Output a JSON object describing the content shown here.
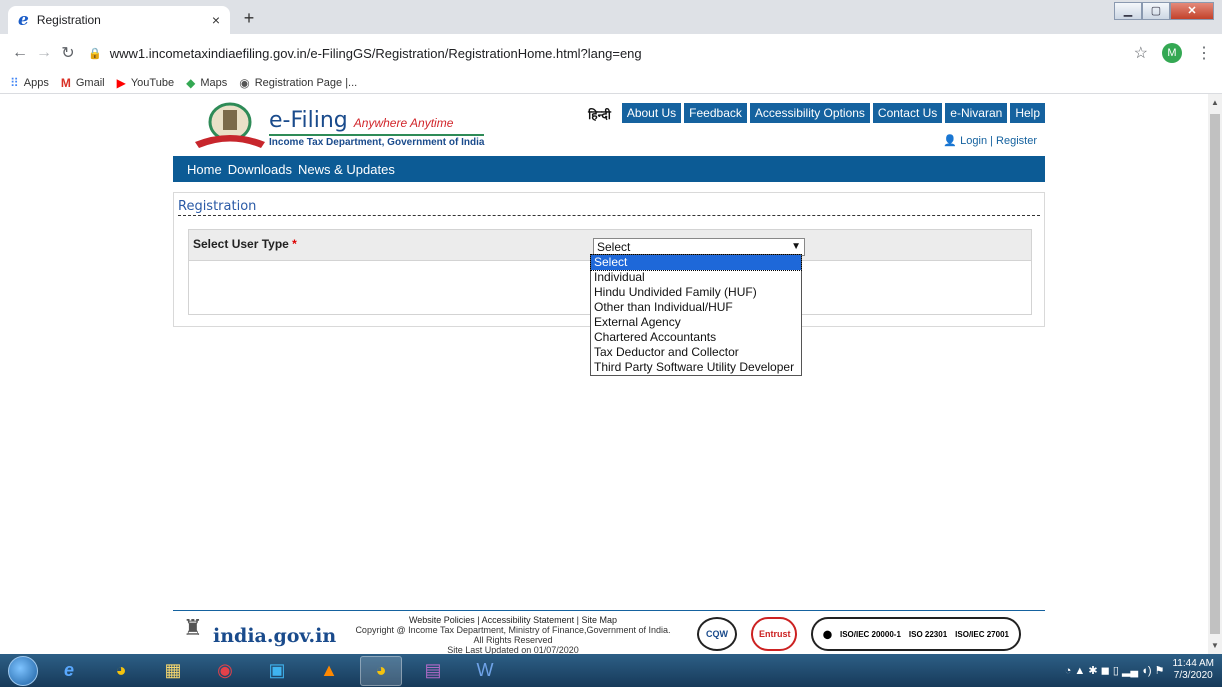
{
  "browser": {
    "tab_title": "Registration",
    "tab_close": "×",
    "new_tab": "+",
    "url": "www1.incometaxindiaefiling.gov.in/e-FilingGS/Registration/RegistrationHome.html?lang=eng",
    "profile_initial": "M",
    "bookmarks": [
      {
        "label": "Apps",
        "icon": "apps-icon"
      },
      {
        "label": "Gmail",
        "icon": "gmail-icon"
      },
      {
        "label": "YouTube",
        "icon": "youtube-icon"
      },
      {
        "label": "Maps",
        "icon": "maps-icon"
      },
      {
        "label": "Registration Page |...",
        "icon": "globe-icon"
      }
    ]
  },
  "header": {
    "brand_main": "e-Filing",
    "brand_tagline": "Anywhere Anytime",
    "brand_dept": "Income Tax Department, Government of India",
    "hindi": "हिन्दी",
    "top_nav": [
      "About Us",
      "Feedback",
      "Accessibility Options",
      "Contact Us",
      "e-Nivaran",
      "Help"
    ],
    "login": "Login | Register"
  },
  "main_nav": [
    "Home",
    "Downloads",
    "News & Updates"
  ],
  "registration": {
    "title": "Registration",
    "user_type_label": "Select User Type",
    "required_mark": "*",
    "selected_value": "Select",
    "options": [
      "Select",
      "Individual",
      "Hindu Undivided Family (HUF)",
      "Other than Individual/HUF",
      "External Agency",
      "Chartered Accountants",
      "Tax Deductor and Collector",
      "Third Party Software Utility Developer"
    ]
  },
  "footer": {
    "links": "Website Policies | Accessibility Statement | Site Map",
    "copyright": "Copyright @ Income Tax Department, Ministry of Finance,Government of India.",
    "rights": "All Rights Reserved",
    "updated": "Site Last Updated on 01/07/2020",
    "india_gov": "india.gov.in",
    "badge_cqw": "CQW",
    "badge_entrust": "Entrust",
    "iso": [
      "ISO/IEC 20000-1",
      "ISO 22301",
      "ISO/IEC 27001"
    ]
  },
  "taskbar": {
    "time": "11:44 AM",
    "date": "7/3/2020"
  }
}
